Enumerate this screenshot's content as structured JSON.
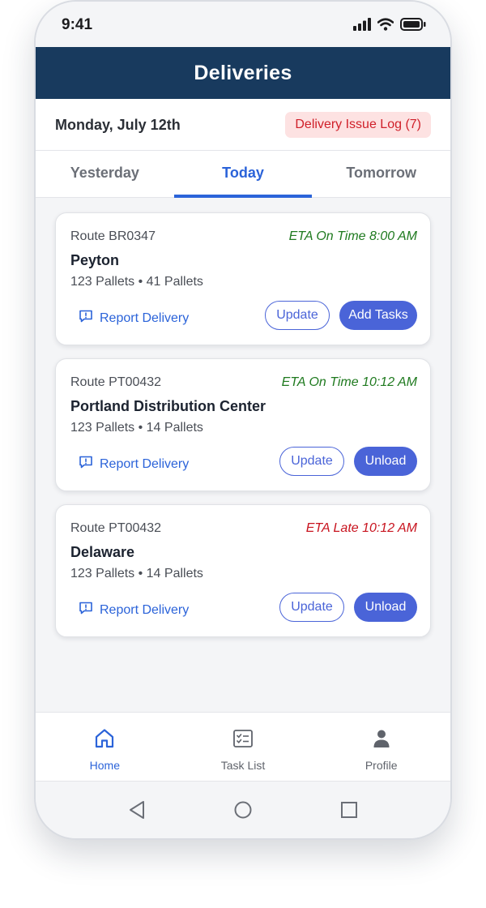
{
  "status_bar": {
    "time": "9:41",
    "icons": [
      "signal-icon",
      "wifi-icon",
      "battery-icon"
    ]
  },
  "header": {
    "title": "Deliveries"
  },
  "date_bar": {
    "date": "Monday, July 12th",
    "issue_log": "Delivery Issue Log (7)"
  },
  "tabs": [
    {
      "label": "Yesterday",
      "active": false
    },
    {
      "label": "Today",
      "active": true
    },
    {
      "label": "Tomorrow",
      "active": false
    }
  ],
  "deliveries": [
    {
      "route": "Route BR0347",
      "eta": "ETA On Time 8:00 AM",
      "eta_status": "on-time",
      "destination": "Peyton",
      "pallets": "123 Pallets • 41 Pallets",
      "report_label": "Report Delivery",
      "secondary_label": "Update",
      "primary_label": "Add Tasks"
    },
    {
      "route": "Route PT00432",
      "eta": "ETA On Time 10:12 AM",
      "eta_status": "on-time",
      "destination": "Portland Distribution Center",
      "pallets": "123 Pallets • 14 Pallets",
      "report_label": "Report Delivery",
      "secondary_label": "Update",
      "primary_label": "Unload"
    },
    {
      "route": "Route PT00432",
      "eta": "ETA Late 10:12 AM",
      "eta_status": "late",
      "destination": "Delaware",
      "pallets": "123 Pallets • 14 Pallets",
      "report_label": "Report Delivery",
      "secondary_label": "Update",
      "primary_label": "Unload"
    }
  ],
  "bottom_nav": [
    {
      "label": "Home",
      "icon": "home-icon",
      "active": true
    },
    {
      "label": "Task List",
      "icon": "task-list-icon",
      "active": false
    },
    {
      "label": "Profile",
      "icon": "profile-icon",
      "active": false
    }
  ],
  "colors": {
    "header_bg": "#183a5e",
    "accent": "#2b63d9",
    "button": "#4a64d8",
    "on_time": "#1f7a1f",
    "late": "#c8141f",
    "issue_badge_bg": "#fde2e2",
    "issue_badge_text": "#d0202a"
  }
}
